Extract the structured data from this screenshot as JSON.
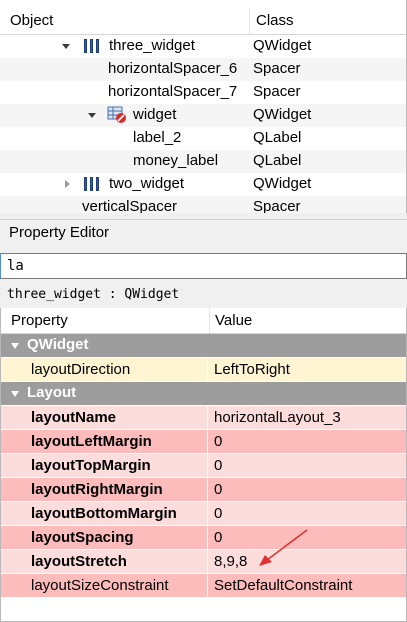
{
  "inspector": {
    "col_object": "Object",
    "col_class": "Class",
    "rows": [
      {
        "name": "three_widget",
        "cls": "QWidget"
      },
      {
        "name": "horizontalSpacer_6",
        "cls": "Spacer"
      },
      {
        "name": "horizontalSpacer_7",
        "cls": "Spacer"
      },
      {
        "name": "widget",
        "cls": "QWidget"
      },
      {
        "name": "label_2",
        "cls": "QLabel"
      },
      {
        "name": "money_label",
        "cls": "QLabel"
      },
      {
        "name": "two_widget",
        "cls": "QWidget"
      },
      {
        "name": "verticalSpacer",
        "cls": "Spacer"
      }
    ]
  },
  "property_editor": {
    "title": "Property Editor",
    "filter_value": "la",
    "object_class": "three_widget : QWidget",
    "col_property": "Property",
    "col_value": "Value",
    "groups": [
      {
        "name": "QWidget",
        "rows": [
          {
            "name": "layoutDirection",
            "value": "LeftToRight"
          }
        ]
      },
      {
        "name": "Layout",
        "rows": [
          {
            "name": "layoutName",
            "value": "horizontalLayout_3"
          },
          {
            "name": "layoutLeftMargin",
            "value": "0"
          },
          {
            "name": "layoutTopMargin",
            "value": "0"
          },
          {
            "name": "layoutRightMargin",
            "value": "0"
          },
          {
            "name": "layoutBottomMargin",
            "value": "0"
          },
          {
            "name": "layoutSpacing",
            "value": "0"
          },
          {
            "name": "layoutStretch",
            "value": "8,9,8"
          },
          {
            "name": "layoutSizeConstraint",
            "value": "SetDefaultConstraint"
          }
        ]
      }
    ]
  },
  "colors": {
    "group_header": "#9d9d9d",
    "qwidget_row": "#fff5d2",
    "layout_row_light": "#fddcdc",
    "layout_row_dark": "#fdbcbc",
    "annotation_arrow": "#e03030"
  }
}
